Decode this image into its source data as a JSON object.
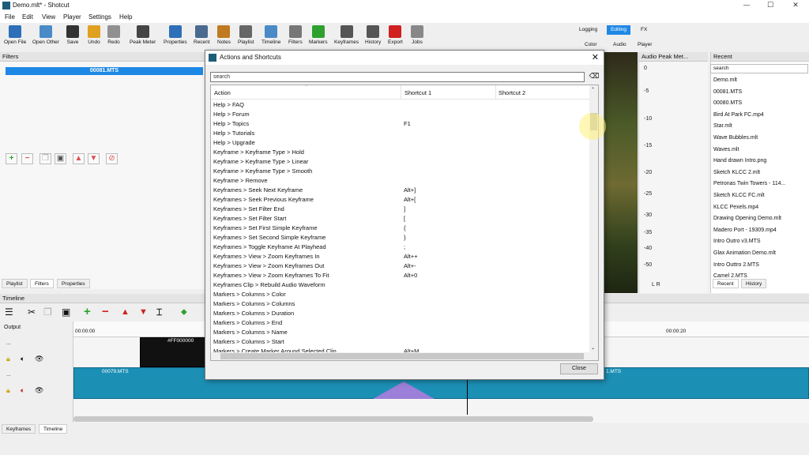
{
  "window": {
    "title": "Demo.mlt* - Shotcut",
    "minimize": "—",
    "maximize": "☐",
    "close": "✕"
  },
  "menu": [
    "File",
    "Edit",
    "View",
    "Player",
    "Settings",
    "Help"
  ],
  "toolbar": [
    {
      "label": "Open File",
      "icon": "folder-icon",
      "color": "#2d6fb8"
    },
    {
      "label": "Open Other",
      "icon": "open-other-icon",
      "color": "#4a8ac7"
    },
    {
      "label": "Save",
      "icon": "save-icon",
      "color": "#333333"
    },
    {
      "label": "Undo",
      "icon": "undo-icon",
      "color": "#e0a020"
    },
    {
      "label": "Redo",
      "icon": "redo-icon",
      "color": "#909090"
    },
    {
      "label": "Peak Meter",
      "icon": "peak-meter-icon",
      "color": "#444444"
    },
    {
      "label": "Properties",
      "icon": "info-icon",
      "color": "#2d6fb8"
    },
    {
      "label": "Recent",
      "icon": "recent-icon",
      "color": "#4a6a90"
    },
    {
      "label": "Notes",
      "icon": "notes-icon",
      "color": "#c07a20"
    },
    {
      "label": "Playlist",
      "icon": "playlist-icon",
      "color": "#666666"
    },
    {
      "label": "Timeline",
      "icon": "timeline-icon",
      "color": "#4a8ac7"
    },
    {
      "label": "Filters",
      "icon": "filter-icon",
      "color": "#777777"
    },
    {
      "label": "Markers",
      "icon": "marker-icon",
      "color": "#2ea02e"
    },
    {
      "label": "Keyframes",
      "icon": "keyframes-icon",
      "color": "#555555"
    },
    {
      "label": "History",
      "icon": "history-icon",
      "color": "#555555"
    },
    {
      "label": "Export",
      "icon": "export-icon",
      "color": "#d02020"
    },
    {
      "label": "Jobs",
      "icon": "jobs-icon",
      "color": "#888888"
    }
  ],
  "modes": {
    "logging": "Logging",
    "editing": "Editing",
    "fx": "FX",
    "color": "Color",
    "audio": "Audio",
    "player": "Player",
    "active_color": "#1e88e5"
  },
  "filters_panel": {
    "title": "Filters",
    "selected_item": "00081.MTS",
    "tabs": [
      "Playlist",
      "Filters",
      "Properties"
    ]
  },
  "peak_panel": {
    "title": "Audio Peak Met...",
    "scale": [
      "0",
      "-5",
      "-10",
      "-15",
      "-20",
      "-25",
      "-30",
      "-35",
      "-40",
      "-50"
    ],
    "channels": "L  R"
  },
  "recent_panel": {
    "title": "Recent",
    "search_placeholder": "search",
    "items": [
      "Demo.mlt",
      "00081.MTS",
      "00080.MTS",
      "Bird At Park FC.mp4",
      "Star.mlt",
      "Wave Bubbles.mlt",
      "Waves.mlt",
      "Hand drawn Intro.png",
      "Sketch KLCC 2.mlt",
      "Petronas Twin Towers - 114...",
      "Sketch KLCC FC.mlt",
      "KLCC Pexels.mp4",
      "Drawing Opening Demo.mlt",
      "Madero Port - 19309.mp4",
      "Intro Outro v3.MTS",
      "Glax Animation Demo.mlt",
      "Intro Outtro 2.MTS",
      "Camel 2.MTS"
    ],
    "tabs": [
      "Recent",
      "History"
    ]
  },
  "timeline": {
    "title": "Timeline",
    "output_label": "Output",
    "track_labels": [
      "...",
      "..."
    ],
    "ruler": [
      "00:00:00",
      "00:00:20"
    ],
    "clips": [
      "#FF000000",
      "00079.MTS",
      "1.MTS"
    ],
    "bottom_tabs": [
      "Keyframes",
      "Timeline"
    ]
  },
  "dialog": {
    "title": "Actions and Shortcuts",
    "search_placeholder": "search",
    "columns": [
      "Action",
      "Shortcut 1",
      "Shortcut 2"
    ],
    "rows": [
      {
        "action": "Help > FAQ",
        "s1": ""
      },
      {
        "action": "Help > Forum",
        "s1": ""
      },
      {
        "action": "Help > Topics",
        "s1": "F1"
      },
      {
        "action": "Help > Tutorials",
        "s1": ""
      },
      {
        "action": "Help > Upgrade",
        "s1": ""
      },
      {
        "action": "Keyframe > Keyframe Type > Hold",
        "s1": ""
      },
      {
        "action": "Keyframe > Keyframe Type > Linear",
        "s1": ""
      },
      {
        "action": "Keyframe > Keyframe Type > Smooth",
        "s1": ""
      },
      {
        "action": "Keyframe > Remove",
        "s1": ""
      },
      {
        "action": "Keyframes > Seek Next Keyframe",
        "s1": "Alt+]"
      },
      {
        "action": "Keyframes > Seek Previous Keyframe",
        "s1": "Alt+["
      },
      {
        "action": "Keyframes > Set Filter End",
        "s1": "]"
      },
      {
        "action": "Keyframes > Set Filter Start",
        "s1": "["
      },
      {
        "action": "Keyframes > Set First Simple Keyframe",
        "s1": "{"
      },
      {
        "action": "Keyframes > Set Second Simple Keyframe",
        "s1": "}"
      },
      {
        "action": "Keyframes > Toggle Keyframe At Playhead",
        "s1": ";"
      },
      {
        "action": "Keyframes > View > Zoom Keyframes In",
        "s1": "Alt++"
      },
      {
        "action": "Keyframes > View > Zoom Keyframes Out",
        "s1": "Alt+-"
      },
      {
        "action": "Keyframes > View > Zoom Keyframes To Fit",
        "s1": "Alt+0"
      },
      {
        "action": "Keyframes Clip > Rebuild Audio Waveform",
        "s1": ""
      },
      {
        "action": "Markers > Columns > Color",
        "s1": ""
      },
      {
        "action": "Markers > Columns > Columns",
        "s1": ""
      },
      {
        "action": "Markers > Columns > Duration",
        "s1": ""
      },
      {
        "action": "Markers > Columns > End",
        "s1": ""
      },
      {
        "action": "Markers > Columns > Name",
        "s1": ""
      },
      {
        "action": "Markers > Columns > Start",
        "s1": ""
      },
      {
        "action": "Markers > Create Marker Around Selected Clip",
        "s1": "Alt+M"
      }
    ],
    "close_label": "Close"
  }
}
